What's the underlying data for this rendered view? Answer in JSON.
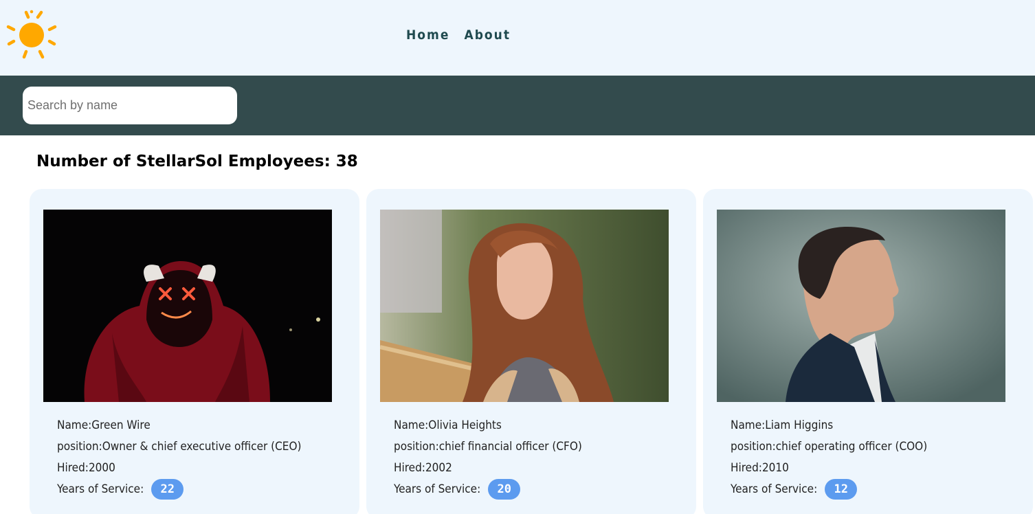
{
  "header": {
    "logo_icon": "sun-icon",
    "logo_color": "#ffa800",
    "nav": [
      {
        "label": "Home"
      },
      {
        "label": "About"
      }
    ]
  },
  "search": {
    "placeholder": "Search by name",
    "value": ""
  },
  "summary": {
    "text": "Number of StellarSol Employees: 38"
  },
  "employees": [
    {
      "photo": "person-in-red-hoodie-led-mask",
      "name": "Name:Green Wire",
      "position": "position:Owner & chief executive officer (CEO)",
      "hired": "Hired:2000",
      "years_label": "Years of Service:",
      "years": "22"
    },
    {
      "photo": "woman-with-long-auburn-hair",
      "name": "Name:Olivia Heights",
      "position": "position:chief financial officer (CFO)",
      "hired": "Hired:2002",
      "years_label": "Years of Service:",
      "years": "20"
    },
    {
      "photo": "man-in-profile-dark-suit",
      "name": "Name:Liam Higgins",
      "position": "position:chief operating officer (COO)",
      "hired": "Hired:2010",
      "years_label": "Years of Service:",
      "years": "12"
    }
  ],
  "colors": {
    "topbar": "#eef6fd",
    "searchbar": "#334b4d",
    "nav_text": "#1f4a4f",
    "badge": "#5c9bef"
  }
}
